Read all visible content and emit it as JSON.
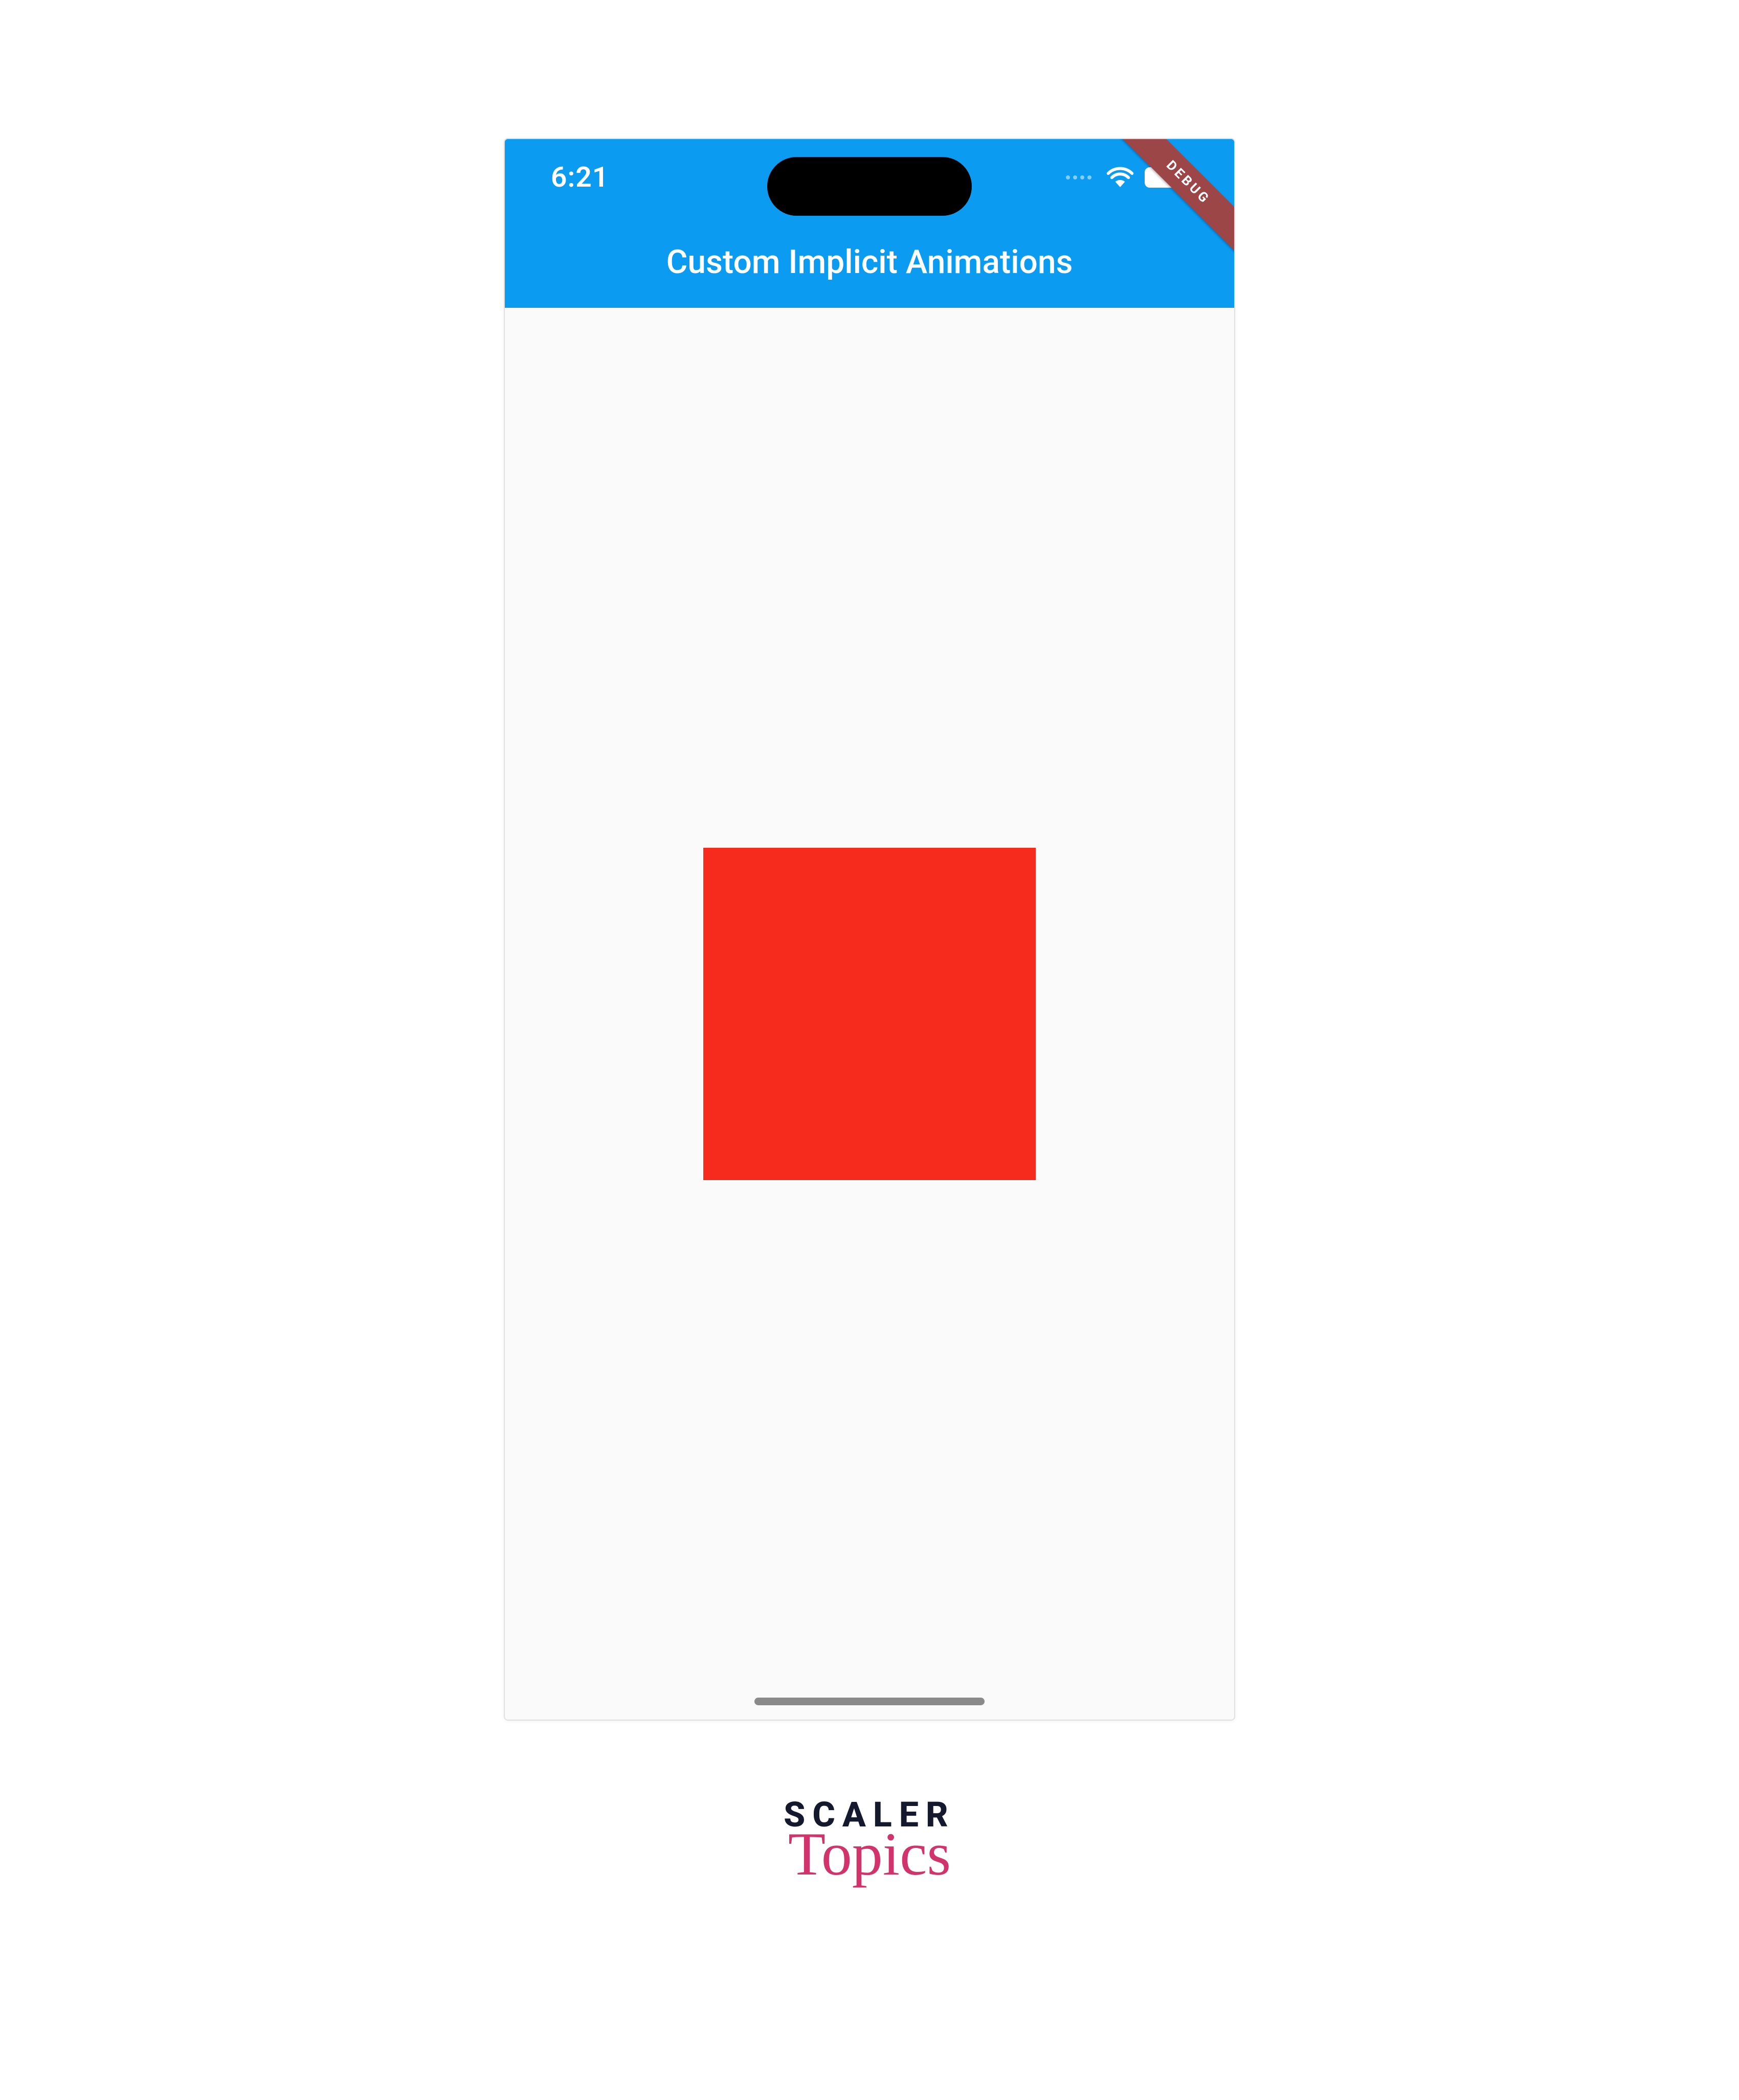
{
  "statusBar": {
    "time": "6:21"
  },
  "debugRibbon": {
    "label": "DEBUG"
  },
  "appBar": {
    "title": "Custom Implicit Animations"
  },
  "content": {
    "squareColor": "#f72a1e"
  },
  "branding": {
    "line1": "SCALER",
    "line2": "Topics"
  },
  "colors": {
    "appBarBackground": "#0b9cf2",
    "bodyBackground": "#fafafa",
    "debugRibbon": "#9d4648"
  }
}
